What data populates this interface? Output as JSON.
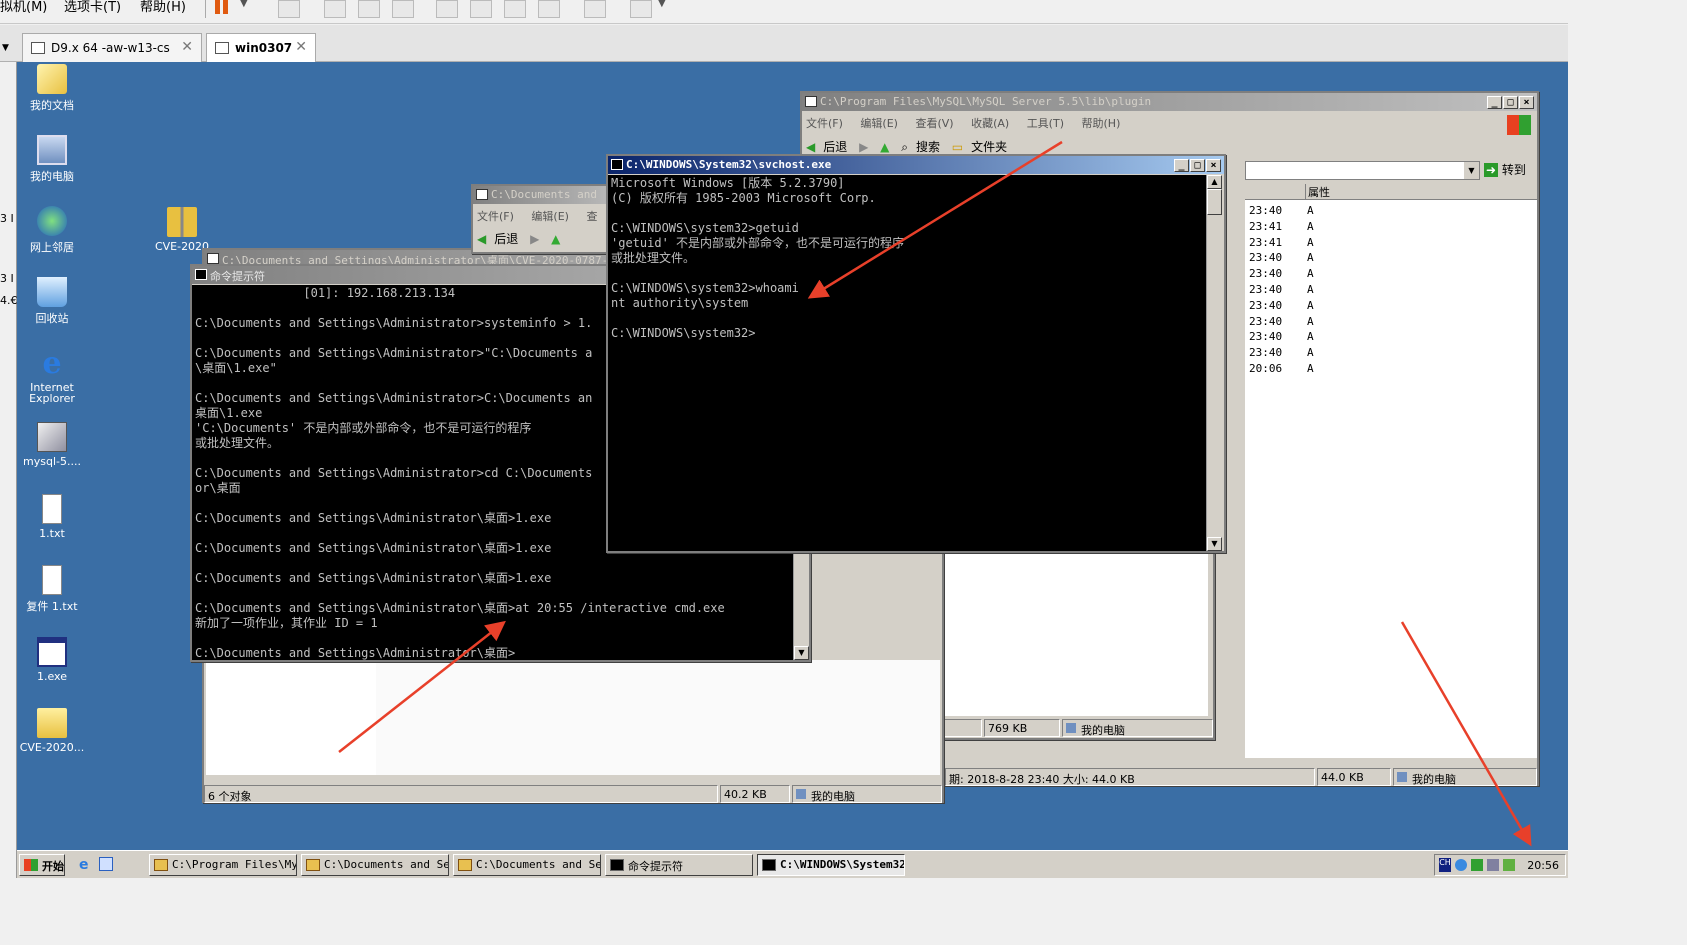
{
  "vm_menu": {
    "items": [
      "拟机(M)",
      "选项卡(T)",
      "帮助(H)"
    ]
  },
  "vm_tabs": [
    {
      "label": "D9.x 64 -aw-w13-cs",
      "active": false
    },
    {
      "label": "win0307",
      "active": true
    }
  ],
  "left_strip": {
    "glyphs": [
      "3 I",
      "3 I",
      "4.€"
    ]
  },
  "desktop_icons": [
    {
      "label": "我的文档",
      "icon": "folder-docs-icon"
    },
    {
      "label": "我的电脑",
      "icon": "computer-icon"
    },
    {
      "label": "网上邻居",
      "icon": "network-icon"
    },
    {
      "label": "回收站",
      "icon": "recycle-bin-icon"
    },
    {
      "label": "Internet Explorer",
      "icon": "ie-icon"
    },
    {
      "label": "mysql-5....",
      "icon": "installer-icon"
    },
    {
      "label": "1.txt",
      "icon": "text-file-icon"
    },
    {
      "label": "复件 1.txt",
      "icon": "text-file-icon"
    },
    {
      "label": "1.exe",
      "icon": "exe-icon"
    },
    {
      "label": "CVE-2020...",
      "icon": "folder-icon"
    },
    {
      "label": "CVE-2020",
      "icon": "zip-folder-icon"
    }
  ],
  "explorer_mysql": {
    "title": "C:\\Program Files\\MySQL\\MySQL Server 5.5\\lib\\plugin",
    "menu": [
      "文件(F)",
      "编辑(E)",
      "查看(V)",
      "收藏(A)",
      "工具(T)",
      "帮助(H)"
    ],
    "toolbar": {
      "back": "后退",
      "search": "搜索",
      "folders": "文件夹"
    },
    "go_label": "转到",
    "column_attr": "属性",
    "rows": [
      {
        "time": "23:40",
        "attr": "A"
      },
      {
        "time": "23:41",
        "attr": "A"
      },
      {
        "time": "23:41",
        "attr": "A"
      },
      {
        "time": "23:40",
        "attr": "A"
      },
      {
        "time": "23:40",
        "attr": "A"
      },
      {
        "time": "23:40",
        "attr": "A"
      },
      {
        "time": "23:40",
        "attr": "A"
      },
      {
        "time": "23:40",
        "attr": "A"
      },
      {
        "time": "23:40",
        "attr": "A"
      },
      {
        "time": "23:40",
        "attr": "A"
      },
      {
        "time": "20:06",
        "attr": "A"
      }
    ],
    "status": {
      "details": "期: 2018-8-28 23:40 大小: 44.0 KB",
      "size": "44.0 KB",
      "location": "我的电脑"
    }
  },
  "explorer_docs2": {
    "status": {
      "size": "769 KB",
      "location": "我的电脑"
    }
  },
  "explorer_docs1": {
    "title": "C:\\Documents and Settings\\Administrator\\桌面\\CVE-2020-0787-",
    "title_short": "C:\\Documents and ",
    "menu": [
      "文件(F)",
      "编辑(E)",
      "查"
    ],
    "toolbar": {
      "back": "后退"
    },
    "status": {
      "objects": "6 个对象",
      "size": "40.2 KB",
      "location": "我的电脑"
    }
  },
  "cmd_window": {
    "title": "命令提示符",
    "lines": [
      "               [01]: 192.168.213.134",
      "",
      "C:\\Documents and Settings\\Administrator>systeminfo > 1.",
      "",
      "C:\\Documents and Settings\\Administrator>\"C:\\Documents a",
      "\\桌面\\1.exe\"",
      "",
      "C:\\Documents and Settings\\Administrator>C:\\Documents an",
      "桌面\\1.exe",
      "'C:\\Documents' 不是内部或外部命令，也不是可运行的程序",
      "或批处理文件。",
      "",
      "C:\\Documents and Settings\\Administrator>cd C:\\Documents",
      "or\\桌面",
      "",
      "C:\\Documents and Settings\\Administrator\\桌面>1.exe",
      "",
      "C:\\Documents and Settings\\Administrator\\桌面>1.exe",
      "",
      "C:\\Documents and Settings\\Administrator\\桌面>1.exe",
      "",
      "C:\\Documents and Settings\\Administrator\\桌面>at 20:55 /interactive cmd.exe",
      "新加了一项作业，其作业 ID = 1",
      "",
      "C:\\Documents and Settings\\Administrator\\桌面>"
    ]
  },
  "svchost_window": {
    "title": "C:\\WINDOWS\\System32\\svchost.exe",
    "lines": [
      "Microsoft Windows [版本 5.2.3790]",
      "(C) 版权所有 1985-2003 Microsoft Corp.",
      "",
      "C:\\WINDOWS\\system32>getuid",
      "'getuid' 不是内部或外部命令，也不是可运行的程序",
      "或批处理文件。",
      "",
      "C:\\WINDOWS\\system32>whoami",
      "nt authority\\system",
      "",
      "C:\\WINDOWS\\system32>"
    ]
  },
  "taskbar": {
    "start_label": "开始",
    "buttons": [
      {
        "label": "C:\\Program Files\\My...",
        "icon": "folder-icon"
      },
      {
        "label": "C:\\Documents and Se...",
        "icon": "folder-icon"
      },
      {
        "label": "C:\\Documents and Se...",
        "icon": "folder-icon"
      },
      {
        "label": "命令提示符",
        "icon": "console-icon"
      },
      {
        "label": "C:\\WINDOWS\\System32...",
        "icon": "console-icon"
      }
    ],
    "clock": "20:56"
  },
  "colors": {
    "desktop": "#3a6ea5",
    "annotation_arrow": "#e8402a",
    "title_active": "#0a246a"
  }
}
